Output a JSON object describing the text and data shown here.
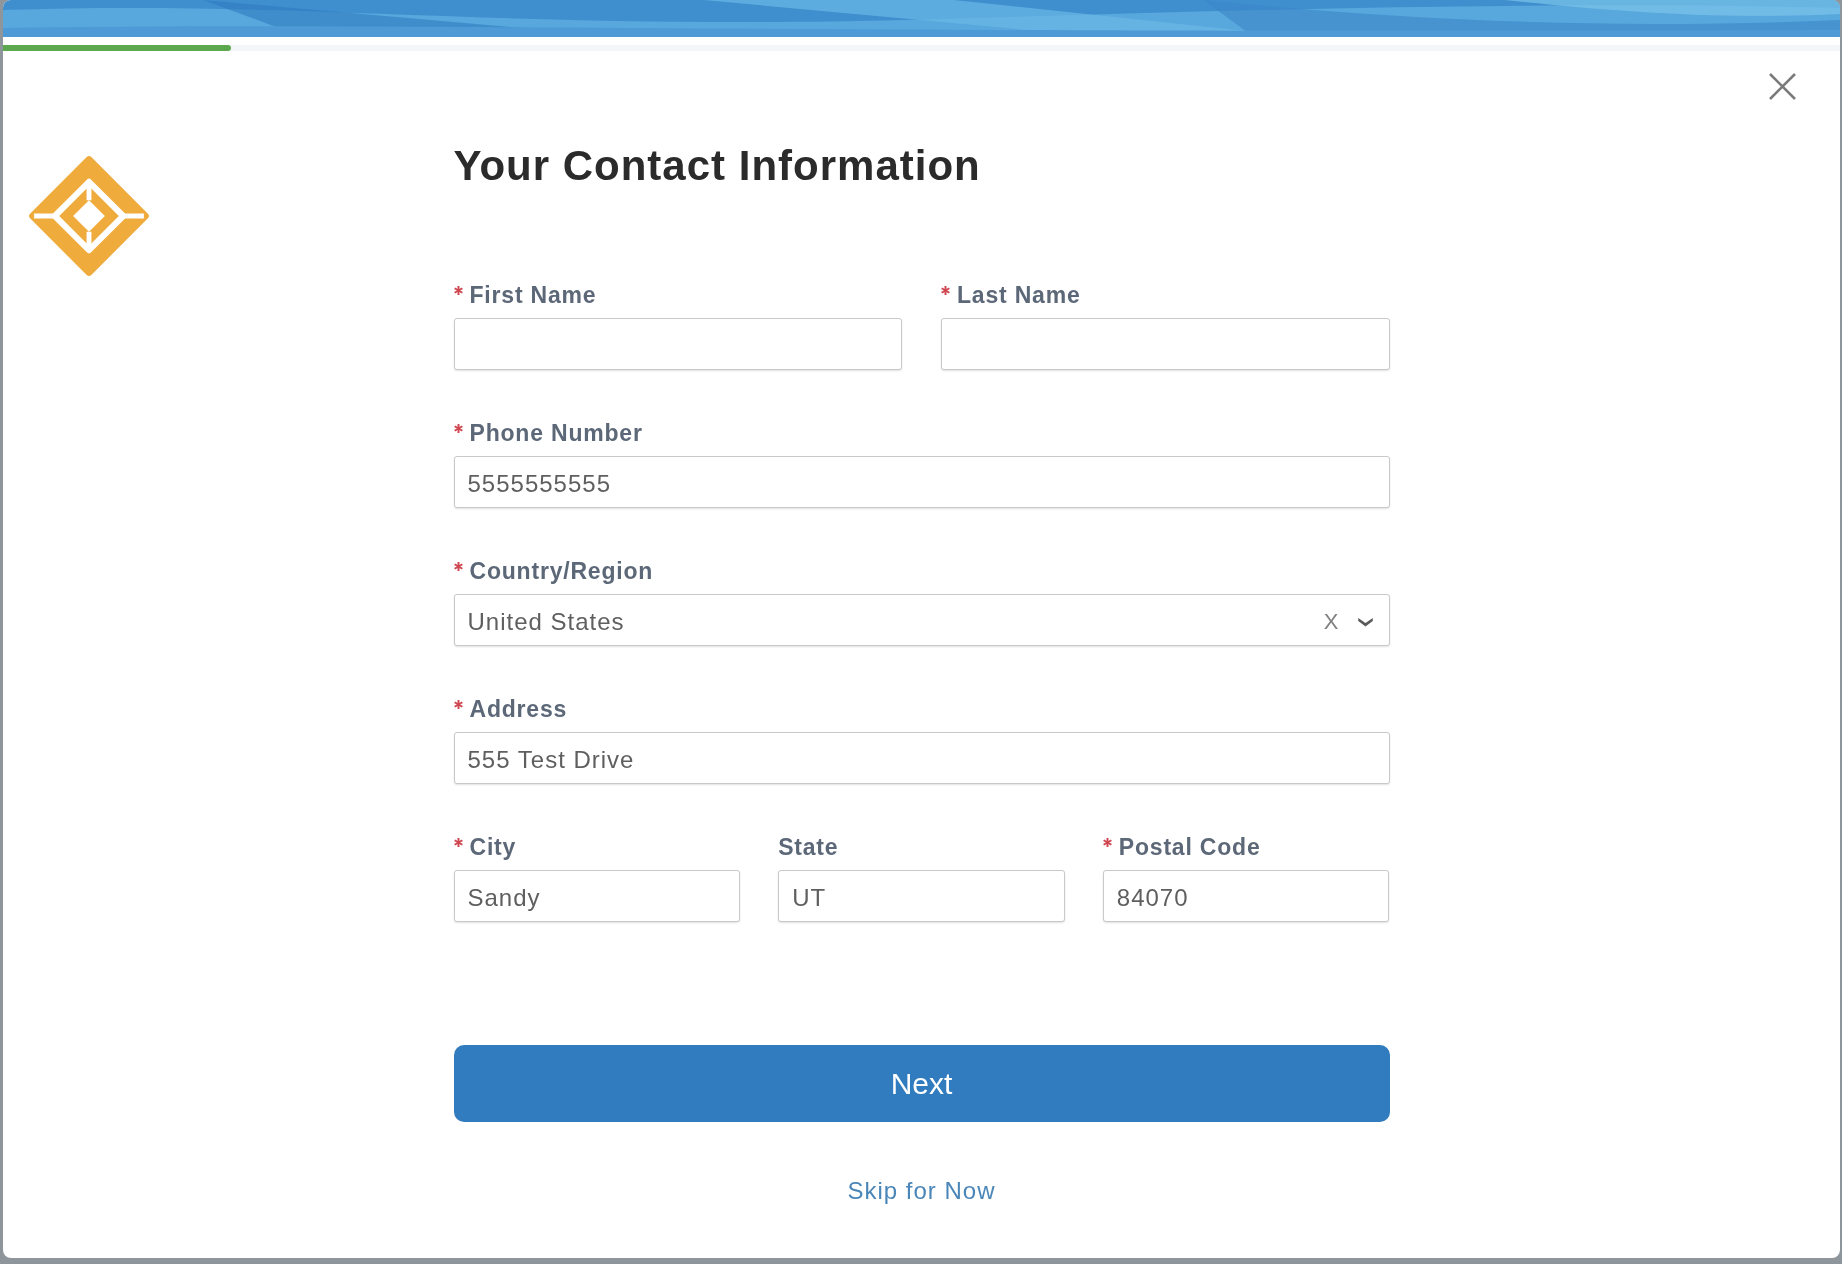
{
  "progress": {
    "level": 0.124
  },
  "title": "Your Contact Information",
  "rows": [
    {
      "fields": [
        {
          "kind": "text",
          "label": "First Name",
          "required": true
        },
        {
          "kind": "text",
          "label": "Last Name",
          "required": true
        }
      ]
    },
    {
      "fields": [
        {
          "kind": "text",
          "label": "Phone Number",
          "required": true,
          "value": "5555555555"
        }
      ]
    },
    {
      "fields": [
        {
          "kind": "select",
          "label": "Country/Region",
          "required": true,
          "value": "United States",
          "clear_label": "X"
        }
      ]
    },
    {
      "fields": [
        {
          "kind": "text",
          "label": "Address",
          "required": true,
          "value": "555 Test Drive"
        }
      ]
    },
    {
      "fields": [
        {
          "kind": "text",
          "label": "City",
          "required": true,
          "value": "Sandy"
        },
        {
          "kind": "text",
          "label": "State",
          "required": false,
          "value": "UT"
        },
        {
          "kind": "text",
          "label": "Postal Code",
          "required": true,
          "value": "84070"
        }
      ]
    }
  ],
  "primary_button": "Next",
  "skip_link": "Skip for Now"
}
